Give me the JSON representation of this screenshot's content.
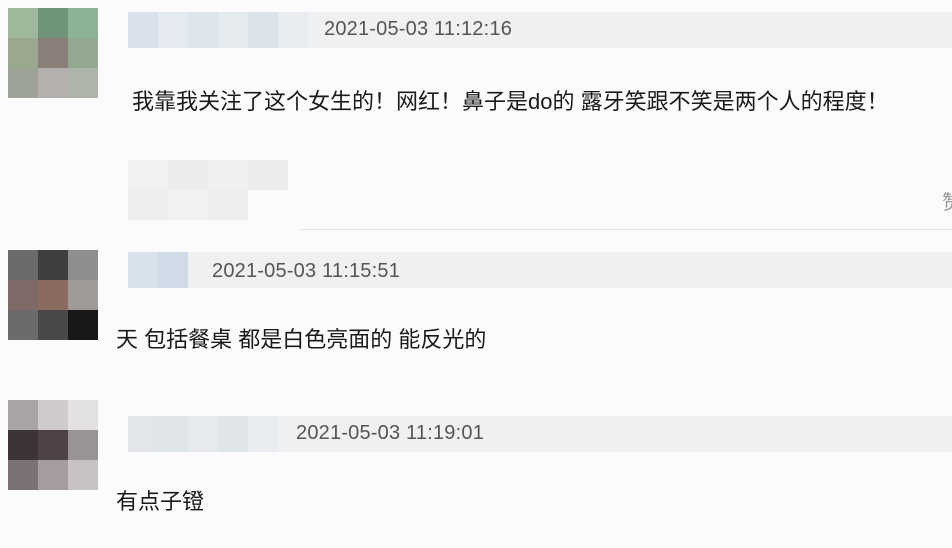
{
  "colors": {
    "background": "#fbfafc",
    "header_band": "#eef0f2",
    "timestamp": "#555555",
    "text": "#1a1a1a"
  },
  "comments": [
    {
      "timestamp": "2021-05-03 11:12:16",
      "text": "我靠我关注了这个女生的！网红！鼻子是do的 露牙笑跟不笑是两个人的程度！"
    },
    {
      "timestamp": "2021-05-03 11:15:51",
      "text": "天 包括餐桌 都是白色亮面的 能反光的"
    },
    {
      "timestamp": "2021-05-03 11:19:01",
      "text": "有点子镫"
    }
  ],
  "edge_glyph": "赞"
}
